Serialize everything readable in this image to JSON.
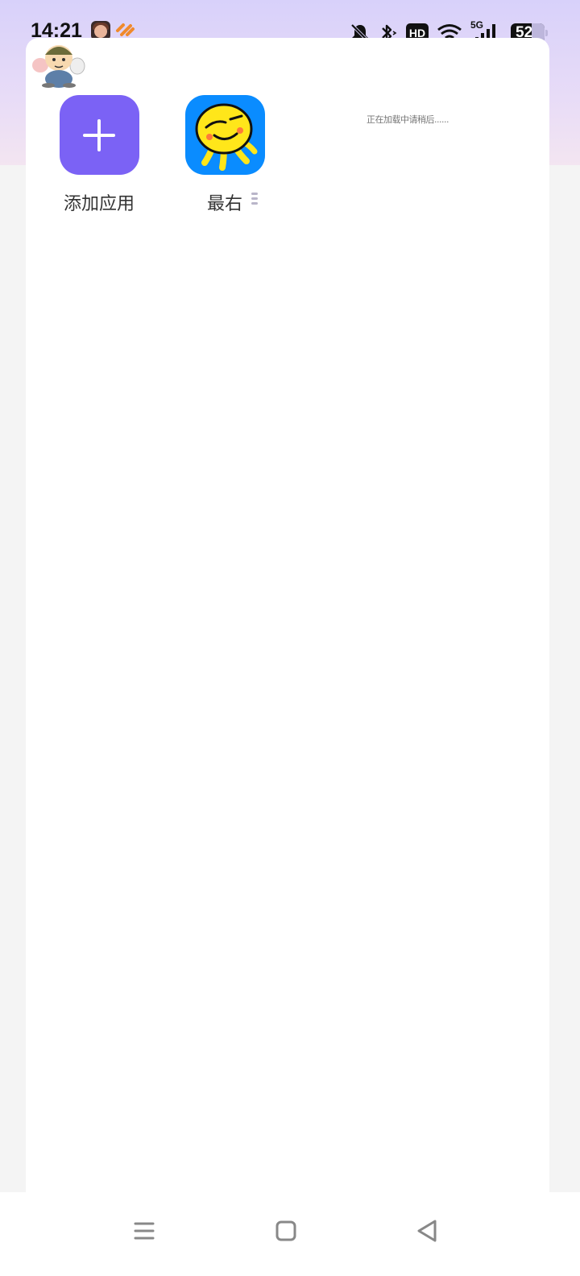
{
  "status_bar": {
    "time": "14:21",
    "icons": [
      "notification-app-icon",
      "orange-app-icon",
      "bell-off-icon",
      "bluetooth-icon",
      "hd-icon",
      "wifi-icon",
      "5g-signal-icon",
      "battery-icon"
    ],
    "hd_label": "HD",
    "network_label": "5G",
    "battery_level": "52"
  },
  "apps": [
    {
      "label": "添加应用",
      "icon": "plus-icon",
      "color": "#7b62f5"
    },
    {
      "label": "最右",
      "icon": "zuiyou-icon",
      "color": "#0a8cff"
    }
  ],
  "loading_text": "正在加载中请稍后......",
  "nav_bar": {
    "buttons": [
      "menu-icon",
      "home-icon",
      "back-icon"
    ]
  }
}
